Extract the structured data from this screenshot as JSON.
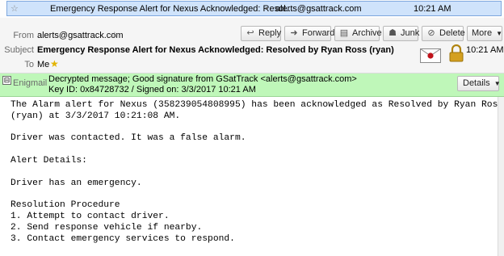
{
  "message_list": {
    "subject": "Emergency Response Alert for Nexus Acknowledged: Resol...",
    "sender": "alerts@gsattrack.com",
    "time": "10:21 AM",
    "bullet": "•"
  },
  "header": {
    "from_label": "From",
    "from_value": "alerts@gsattrack.com",
    "subject_label": "Subject",
    "subject_value": "Emergency Response Alert for Nexus Acknowledged: Resolved by Ryan Ross (ryan)",
    "to_label": "To",
    "to_value": "Me",
    "time": "10:21 AM",
    "buttons": {
      "reply": "Reply",
      "forward": "Forward",
      "archive": "Archive",
      "junk": "Junk",
      "delete": "Delete",
      "more": "More"
    }
  },
  "enigmail": {
    "label": "Enigmail",
    "line1": "Decrypted message; Good signature from GSatTrack <alerts@gsattrack.com>",
    "line2": "Key ID: 0x84728732 / Signed on: 3/3/2017 10:21 AM",
    "details_button": "Details"
  },
  "body": {
    "text": "The Alarm alert for Nexus (358239054808995) has been acknowledged as Resolved by Ryan Ross\n(ryan) at 3/3/2017 10:21:08 AM.\n\nDriver was contacted. It was a false alarm.\n\nAlert Details:\n\nDriver has an emergency.\n\nResolution Procedure\n1. Attempt to contact driver.\n2. Send response vehicle if nearby.\n3. Contact emergency services to respond."
  },
  "icons": [
    "star-icon",
    "reply-icon",
    "forward-icon",
    "archive-icon",
    "junk-icon",
    "delete-icon",
    "dropdown-arrow-icon",
    "envelope-icon",
    "lock-icon",
    "expand-toggle-icon"
  ],
  "colors": {
    "selected_row": "#cfe3fb",
    "enigmail_bar": "#bff7b9",
    "lock": "#d4a020",
    "envelope_seal": "#c0141c"
  }
}
